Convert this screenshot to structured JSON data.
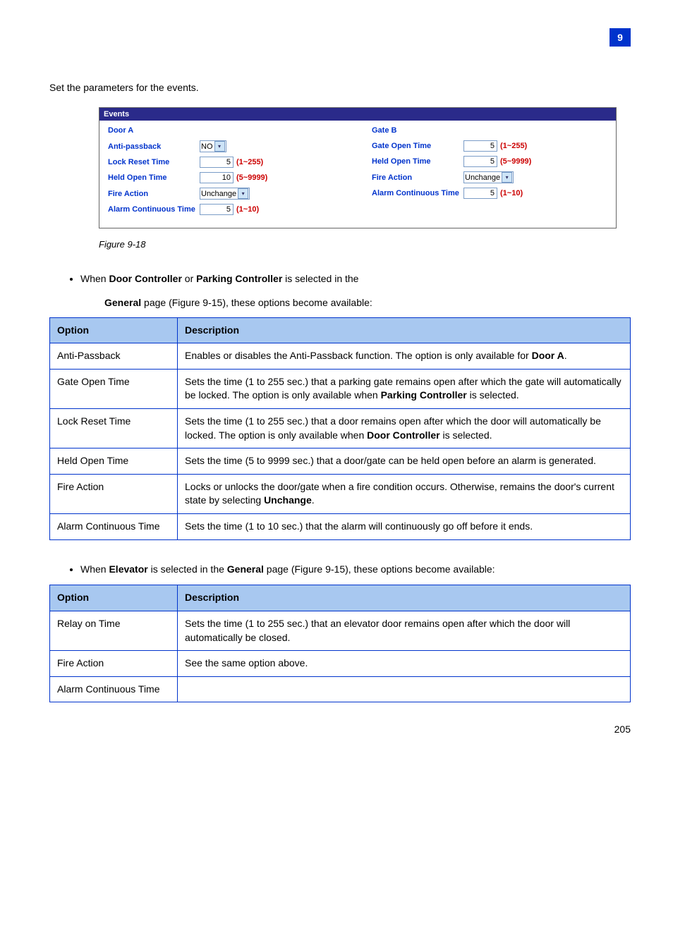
{
  "chapter": "9",
  "heading": "Set the parameters for the events.",
  "events": {
    "title": "Events",
    "doorA": {
      "head": "Door A",
      "antipassback": {
        "label": "Anti-passback",
        "value": "NO"
      },
      "lockreset": {
        "label": "Lock Reset Time",
        "value": "5",
        "range": "(1~255)"
      },
      "heldopen": {
        "label": "Held Open Time",
        "value": "10",
        "range": "(5~9999)"
      },
      "fireaction": {
        "label": "Fire Action",
        "value": "Unchange"
      },
      "alarmcont": {
        "label": "Alarm Continuous Time",
        "value": "5",
        "range": "(1~10)"
      }
    },
    "gateB": {
      "head": "Gate B",
      "gateopen": {
        "label": "Gate Open Time",
        "value": "5",
        "range": "(1~255)"
      },
      "heldopen": {
        "label": "Held Open Time",
        "value": "5",
        "range": "(5~9999)"
      },
      "fireaction": {
        "label": "Fire Action",
        "value": "Unchange"
      },
      "alarmcont": {
        "label": "Alarm Continuous Time",
        "value": "5",
        "range": "(1~10)"
      }
    }
  },
  "figcaption": "Figure 9-18",
  "bullet1": {
    "pre": "When ",
    "opt1": "Door Controller",
    "mid1": " or ",
    "opt2": "Parking Controller",
    "mid2": " is selected in the ",
    "page": "General",
    "after": " page (Figure 9-15), these options become available:"
  },
  "table1": {
    "h1": "Option",
    "h2": "Description",
    "rows": [
      {
        "name": "Anti-Passback",
        "desc_pre": "Enables or disables the Anti-Passback function. The option is only available for ",
        "bold": "Door A",
        "desc_post": "."
      },
      {
        "name": "Gate Open Time",
        "desc_pre": "Sets the time (1 to 255 sec.) that a parking gate remains open after which the gate will automatically be locked. The option is only available when ",
        "bold": "Parking Controller",
        "desc_post": " is selected."
      },
      {
        "name": "Lock Reset Time",
        "desc_pre": "Sets the time (1 to 255 sec.) that a door remains open after which the door will automatically be locked. The option is only available when ",
        "bold": "Door Controller",
        "desc_post": " is selected."
      },
      {
        "name": "Held Open Time",
        "desc": "Sets the time (5 to 9999 sec.) that a door/gate can be held open before an alarm is generated."
      },
      {
        "name": "Fire Action",
        "desc_pre": "Locks or unlocks the door/gate when a fire condition occurs. Otherwise, remains the door's current state by selecting ",
        "bold": "Unchange",
        "desc_post": "."
      },
      {
        "name": "Alarm Continuous Time",
        "desc": "Sets the time (1 to 10 sec.) that the alarm will continuously go off before it ends."
      }
    ]
  },
  "bullet2": {
    "pre": "When ",
    "opt": "Elevator",
    "mid1": " is selected in the ",
    "page": "General",
    "mid2": " page (Figure 9-15), these options become available:"
  },
  "table2": {
    "h1": "Option",
    "h2": "Description",
    "rows": [
      {
        "name": "Relay on Time",
        "desc": "Sets the time (1 to 255 sec.) that an elevator door remains open after which the door will automatically be closed."
      },
      {
        "name": "Fire Action",
        "desc": "See the same option above."
      },
      {
        "name": "Alarm Continuous Time",
        "desc": ""
      }
    ]
  },
  "pagenum": "205"
}
